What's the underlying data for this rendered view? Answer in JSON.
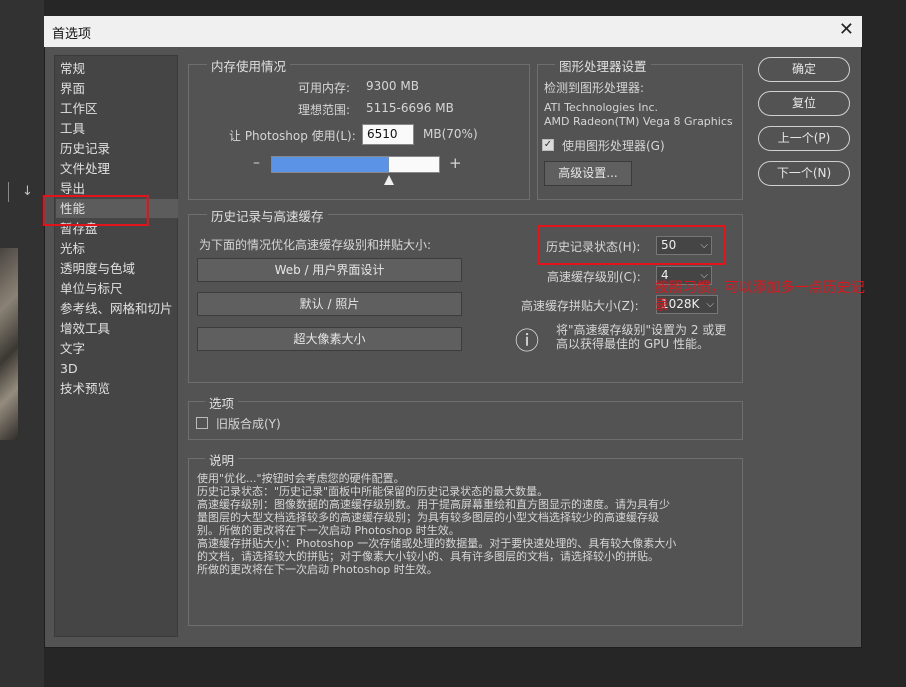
{
  "dialog": {
    "title": "首选项",
    "close": "✕"
  },
  "nav": [
    {
      "label": "常规"
    },
    {
      "label": "界面"
    },
    {
      "label": "工作区"
    },
    {
      "label": "工具"
    },
    {
      "label": "历史记录"
    },
    {
      "label": "文件处理"
    },
    {
      "label": "导出"
    },
    {
      "label": "性能"
    },
    {
      "label": "暂存盘"
    },
    {
      "label": "光标"
    },
    {
      "label": "透明度与色域"
    },
    {
      "label": "单位与标尺"
    },
    {
      "label": "参考线、网格和切片"
    },
    {
      "label": "增效工具"
    },
    {
      "label": "文字"
    },
    {
      "label": "3D"
    },
    {
      "label": "技术预览"
    }
  ],
  "memory": {
    "title": "内存使用情况",
    "available_label": "可用内存:",
    "available_value": "9300 MB",
    "ideal_label": "理想范围:",
    "ideal_value": "5115-6696 MB",
    "let_label": "让 Photoshop 使用(L):",
    "let_value": "6510",
    "let_unit": "MB(70%)",
    "slider_minus": "–",
    "slider_plus": "+",
    "slider_fraction": 0.7
  },
  "gpu": {
    "title": "图形处理器设置",
    "detected_label": "检测到图形处理器:",
    "vendor": "ATI Technologies Inc.",
    "model": "AMD Radeon(TM) Vega 8 Graphics",
    "use_gpu_label": "使用图形处理器(G)",
    "use_gpu_checked": true,
    "advanced_button": "高级设置..."
  },
  "history": {
    "title": "历史记录与高速缓存",
    "optimize_label": "为下面的情况优化高速缓存级别和拼贴大小:",
    "buttons": [
      "Web / 用户界面设计",
      "默认 / 照片",
      "超大像素大小"
    ],
    "states_label": "历史记录状态(H):",
    "states_value": "50",
    "cache_levels_label": "高速缓存级别(C):",
    "cache_levels_value": "4",
    "tile_size_label": "高速缓存拼贴大小(Z):",
    "tile_size_value": "1028K",
    "info_icon": "ⓘ",
    "info_text_1": "将\"高速缓存级别\"设置为 2 或更",
    "info_text_2": "高以获得最佳的 GPU 性能。"
  },
  "annotation": {
    "text_1": "按照习惯，可以添加多一点历史记",
    "text_2": "录"
  },
  "options": {
    "title": "选项",
    "legacy_label": "旧版合成(Y)",
    "legacy_checked": false
  },
  "description": {
    "title": "说明",
    "lines": [
      "使用\"优化...\"按钮时会考虑您的硬件配置。",
      "历史记录状态：\"历史记录\"面板中所能保留的历史记录状态的最大数量。",
      "高速缓存级别：图像数据的高速缓存级别数。用于提高屏幕重绘和直方图显示的速度。请为具有少",
      "量图层的大型文档选择较多的高速缓存级别；为具有较多图层的小型文档选择较少的高速缓存级",
      "别。所做的更改将在下一次启动 Photoshop 时生效。",
      "高速缓存拼贴大小：Photoshop 一次存储或处理的数据量。对于要快速处理的、具有较大像素大小",
      "的文档，请选择较大的拼贴；对于像素大小较小的、具有许多图层的文档，请选择较小的拼贴。",
      "所做的更改将在下一次启动 Photoshop 时生效。"
    ]
  },
  "actions": {
    "ok": "确定",
    "reset": "复位",
    "prev": "上一个(P)",
    "next": "下一个(N)"
  },
  "colors": {
    "annotation_red": "#e0141a",
    "slider_blue": "#5b93e6",
    "dialog_bg": "#535353"
  }
}
